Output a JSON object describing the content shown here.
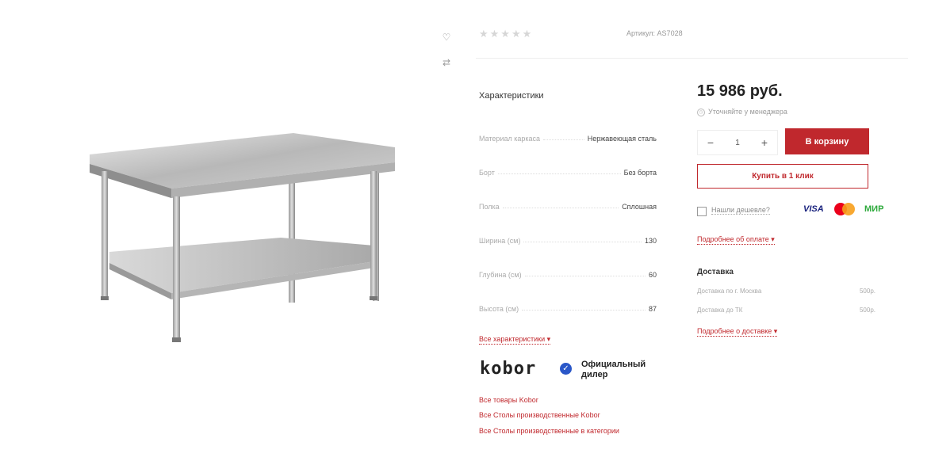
{
  "product": {
    "image_alt": "Стол производственный из нержавеющей стали",
    "rating_stars": "★★★★★",
    "article": "Артикул: AS7028"
  },
  "side_icons": {
    "favorite": "♡",
    "compare": "⇄"
  },
  "characteristics": {
    "title": "Характеристики",
    "rows": [
      {
        "name": "Материал каркаса",
        "value": "Нержавеющая сталь"
      },
      {
        "name": "Борт",
        "value": "Без борта"
      },
      {
        "name": "Полка",
        "value": "Сплошная"
      },
      {
        "name": "Ширина (см)",
        "value": "130"
      },
      {
        "name": "Глубина (см)",
        "value": "60"
      },
      {
        "name": "Высота (см)",
        "value": "87"
      }
    ],
    "all_link": "Все характеристики ▾"
  },
  "brand": {
    "logo_text": "kobor",
    "dealer_line1": "Официальный",
    "dealer_line2": "дилер",
    "check_glyph": "✓",
    "links": [
      "Все товары Kobor",
      "Все Столы производственные Kobor",
      "Все Столы производственные в категории"
    ]
  },
  "purchase": {
    "price": "15 986 руб.",
    "clarify": "Уточняйте у менеджера",
    "qty_minus": "−",
    "qty_value": "1",
    "qty_plus": "+",
    "cart_button": "В корзину",
    "oneclick_button": "Купить в 1 клик",
    "cheaper": "Нашли дешевле?",
    "payment_visa": "VISA",
    "payment_mir": "МИР",
    "payment_link": "Подробнее об оплате ▾"
  },
  "delivery": {
    "title": "Доставка",
    "rows": [
      {
        "name": "Доставка по г. Москва",
        "value": "500р."
      },
      {
        "name": "Доставка до ТК",
        "value": "500р."
      }
    ],
    "link": "Подробнее о доставке ▾"
  },
  "colors": {
    "accent": "#c0282d",
    "verified_badge": "#2a57c8"
  }
}
